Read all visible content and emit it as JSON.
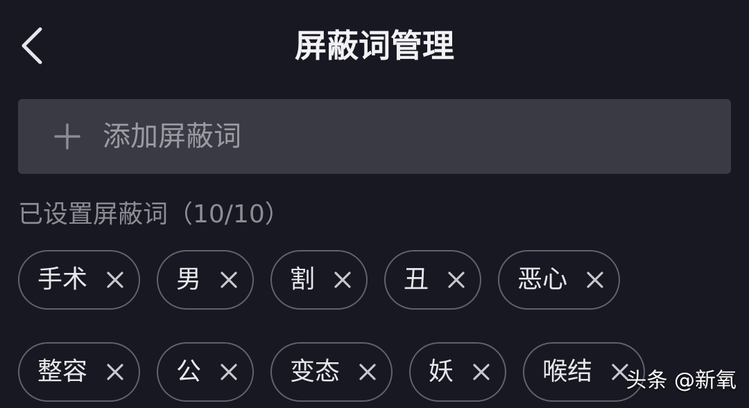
{
  "header": {
    "back_icon": "chevron-left-icon",
    "title": "屏蔽词管理"
  },
  "add_bar": {
    "icon": "plus-icon",
    "placeholder": "添加屏蔽词"
  },
  "section": {
    "label": "已设置屏蔽词（10/10）",
    "count_current": 10,
    "count_max": 10
  },
  "words": [
    {
      "label": "手术",
      "remove_icon": "close-icon"
    },
    {
      "label": "男",
      "remove_icon": "close-icon"
    },
    {
      "label": "割",
      "remove_icon": "close-icon"
    },
    {
      "label": "丑",
      "remove_icon": "close-icon"
    },
    {
      "label": "恶心",
      "remove_icon": "close-icon"
    },
    {
      "label": "整容",
      "remove_icon": "close-icon"
    },
    {
      "label": "公",
      "remove_icon": "close-icon"
    },
    {
      "label": "变态",
      "remove_icon": "close-icon"
    },
    {
      "label": "妖",
      "remove_icon": "close-icon"
    },
    {
      "label": "喉结",
      "remove_icon": "close-icon"
    }
  ],
  "watermark": {
    "text": "头条 @新氧"
  },
  "colors": {
    "background": "#181822",
    "input_background": "#3a3a44",
    "chip_border": "#62626c",
    "secondary_text": "#8c8c94"
  }
}
